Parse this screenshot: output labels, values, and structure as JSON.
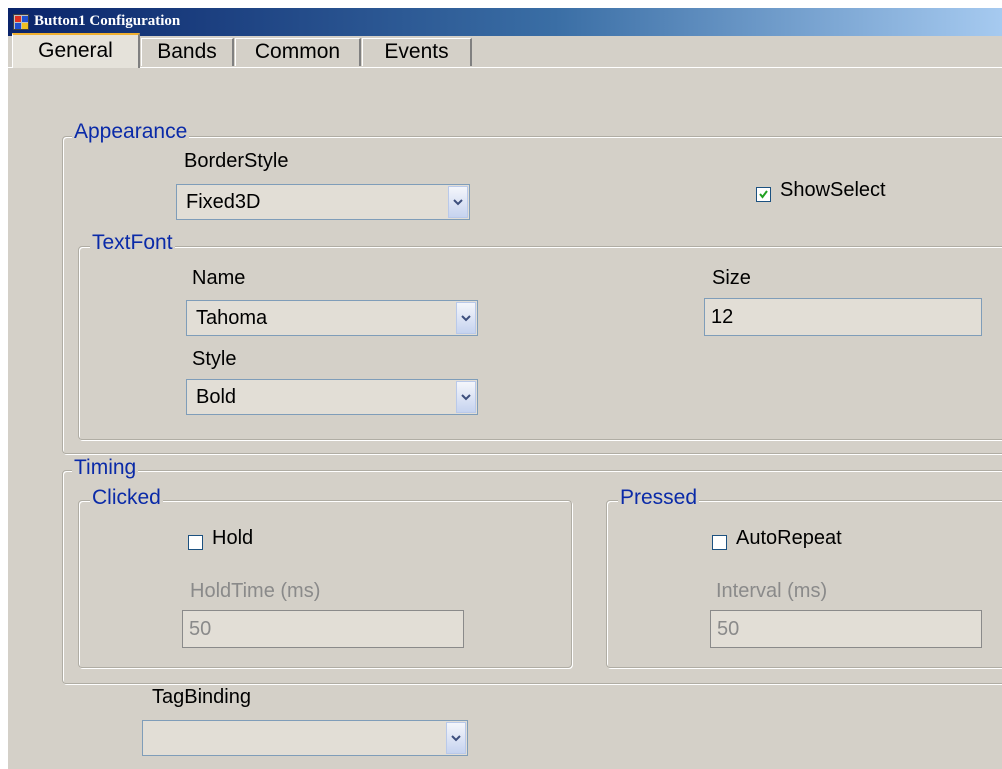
{
  "window": {
    "title": "Button1 Configuration"
  },
  "tabs": [
    {
      "label": "General",
      "active": true
    },
    {
      "label": "Bands",
      "active": false
    },
    {
      "label": "Common",
      "active": false
    },
    {
      "label": "Events",
      "active": false
    }
  ],
  "appearance": {
    "legend": "Appearance",
    "border_style_label": "BorderStyle",
    "border_style_value": "Fixed3D",
    "show_select_label": "ShowSelect",
    "show_select_checked": true
  },
  "text_font": {
    "legend": "TextFont",
    "name_label": "Name",
    "name_value": "Tahoma",
    "size_label": "Size",
    "size_value": "12",
    "style_label": "Style",
    "style_value": "Bold"
  },
  "timing": {
    "legend": "Timing",
    "clicked": {
      "legend": "Clicked",
      "hold_label": "Hold",
      "hold_checked": false,
      "hold_time_label": "HoldTime (ms)",
      "hold_time_value": "50"
    },
    "pressed": {
      "legend": "Pressed",
      "auto_repeat_label": "AutoRepeat",
      "auto_repeat_checked": false,
      "interval_label": "Interval (ms)",
      "interval_value": "50"
    }
  },
  "tag_binding": {
    "label": "TagBinding",
    "value": ""
  },
  "colors": {
    "accent": "#0a2aa8",
    "titlebar": "#0a246a",
    "face": "#d4d0c8"
  }
}
